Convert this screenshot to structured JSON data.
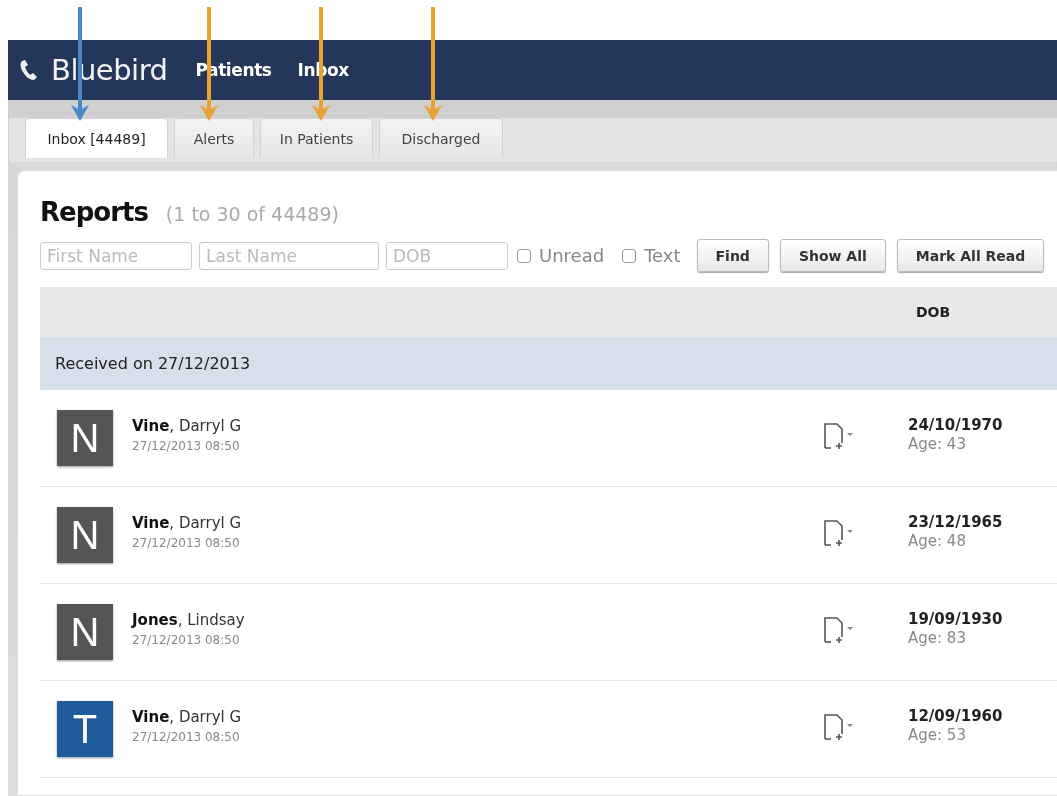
{
  "annotations": [
    {
      "color": "#4a86c8"
    },
    {
      "color": "#e8a230"
    },
    {
      "color": "#e8a230"
    },
    {
      "color": "#e8a230"
    }
  ],
  "header": {
    "brand": "Bluebird",
    "nav": [
      "Patients",
      "Inbox"
    ]
  },
  "tabs": [
    {
      "label": "Inbox [44489]",
      "selected": true
    },
    {
      "label": "Alerts",
      "selected": false
    },
    {
      "label": "In Patients",
      "selected": false
    },
    {
      "label": "Discharged",
      "selected": false
    }
  ],
  "reports": {
    "title": "Reports",
    "range": "(1 to 30 of 44489)",
    "filters": [
      {
        "kind": "field",
        "placeholder": "First Name"
      },
      {
        "kind": "field",
        "placeholder": "Last Name"
      },
      {
        "kind": "field",
        "placeholder": "DOB"
      },
      {
        "kind": "checkbox",
        "label": "Unread",
        "checked": false
      },
      {
        "kind": "checkbox",
        "label": "Text",
        "checked": false
      }
    ],
    "buttons": [
      "Find",
      "Show All",
      "Mark All Read"
    ]
  },
  "table": {
    "columns": [
      "DOB"
    ],
    "group": "Received on 27/12/2013",
    "rows": [
      {
        "letter": "N",
        "color": "#555555",
        "name": "**Vine**, Darryl G",
        "received": "27/12/2013 08:50",
        "dob": "24/10/1970",
        "age": "Age: 43"
      },
      {
        "letter": "N",
        "color": "#555555",
        "name": "**Vine**, Darryl G",
        "received": "27/12/2013 08:50",
        "dob": "23/12/1965",
        "age": "Age: 48"
      },
      {
        "letter": "N",
        "color": "#555555",
        "name": "**Jones**, Lindsay",
        "received": "27/12/2013 08:50",
        "dob": "19/09/1930",
        "age": "Age: 83"
      },
      {
        "letter": "T",
        "color": "#1f5a9a",
        "name": "**Vine**, Darryl G",
        "received": "27/12/2013 08:50",
        "dob": "12/09/1960",
        "age": "Age: 53"
      }
    ]
  }
}
